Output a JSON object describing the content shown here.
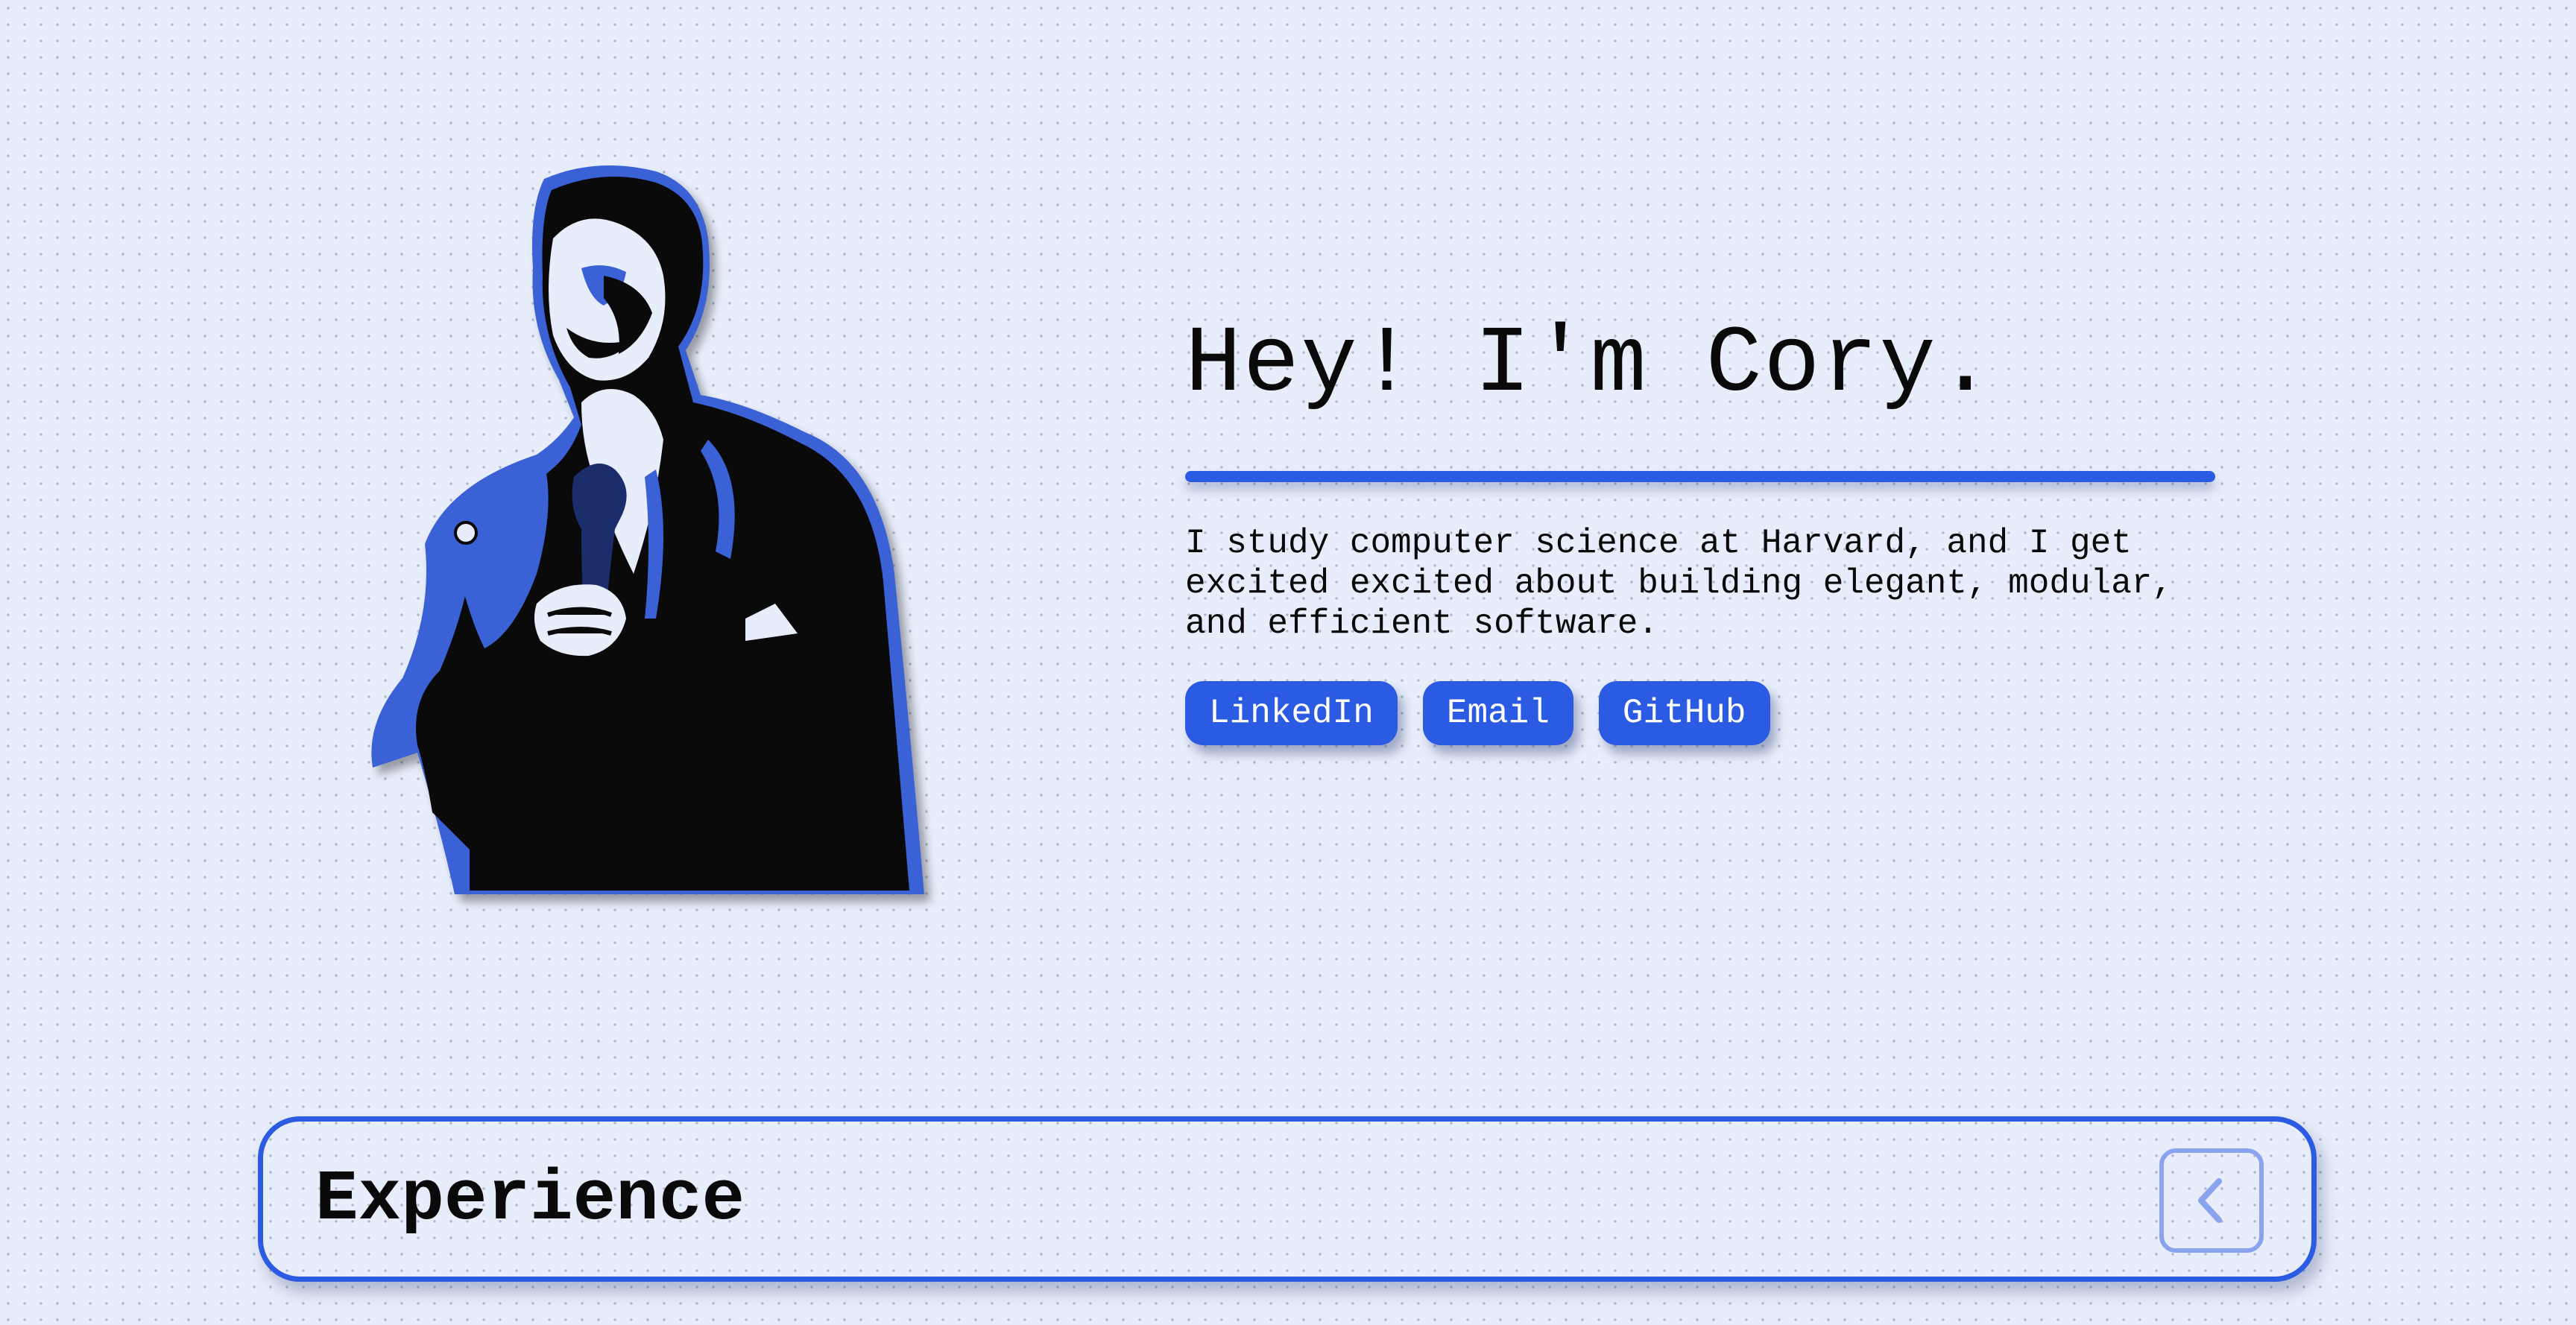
{
  "hero": {
    "title": "Hey! I'm Cory.",
    "bio": "I study computer science at Harvard, and I get excited excited about building elegant, modular, and efficient software.",
    "links": [
      {
        "label": "LinkedIn"
      },
      {
        "label": "Email"
      },
      {
        "label": "GitHub"
      }
    ]
  },
  "experience": {
    "title": "Experience",
    "toggle_icon": "chevron-left-icon"
  },
  "colors": {
    "accent": "#2c5be3",
    "background": "#e8edfb",
    "text": "#0a0a0a",
    "toggle_border": "#8aa3ee"
  }
}
